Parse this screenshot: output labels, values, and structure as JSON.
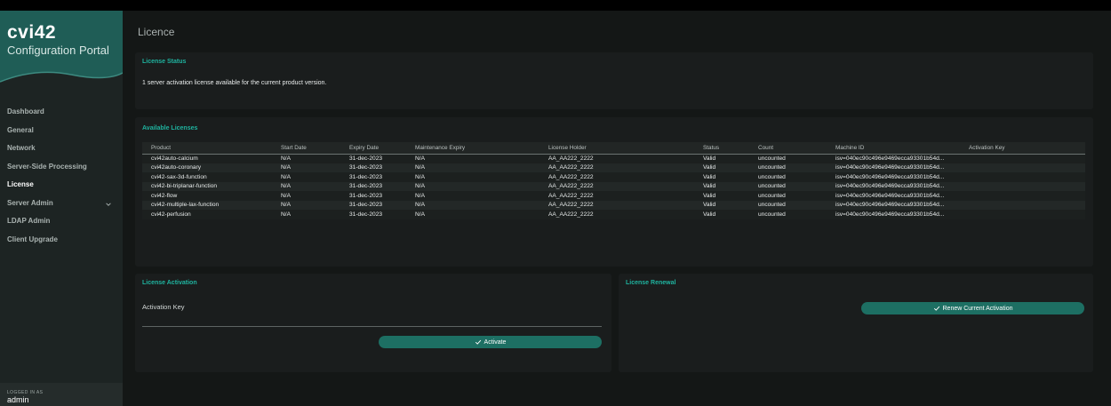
{
  "brand": {
    "logo": "cvi42",
    "subtitle": "Configuration Portal"
  },
  "nav": [
    {
      "label": "Dashboard",
      "active": false
    },
    {
      "label": "General",
      "active": false
    },
    {
      "label": "Network",
      "active": false
    },
    {
      "label": "Server-Side Processing",
      "active": false
    },
    {
      "label": "License",
      "active": true
    },
    {
      "label": "Server Admin",
      "active": false,
      "has_chevron": true
    },
    {
      "label": "LDAP Admin",
      "active": false
    },
    {
      "label": "Client Upgrade",
      "active": false
    }
  ],
  "footer": {
    "label": "LOGGED IN AS",
    "user": "admin"
  },
  "page": {
    "title": "Licence"
  },
  "status": {
    "title": "License Status",
    "text": "1 server activation license available for the current product version."
  },
  "available": {
    "title": "Available Licenses",
    "columns": [
      "Product",
      "Start Date",
      "Expiry Date",
      "Maintenance Expiry",
      "License Holder",
      "Status",
      "Count",
      "Machine ID",
      "Activation Key"
    ],
    "rows": [
      [
        "cvi42auto-calcium",
        "N/A",
        "31-dec-2023",
        "N/A",
        "AA_AA222_2222",
        "Valid",
        "uncounted",
        "isv=040ec90c496e9469ecca93301b54d...",
        ""
      ],
      [
        "cvi42auto-coronary",
        "N/A",
        "31-dec-2023",
        "N/A",
        "AA_AA222_2222",
        "Valid",
        "uncounted",
        "isv=040ec90c496e9469ecca93301b54d...",
        ""
      ],
      [
        "cvi42-sax-3d-function",
        "N/A",
        "31-dec-2023",
        "N/A",
        "AA_AA222_2222",
        "Valid",
        "uncounted",
        "isv=040ec90c496e9469ecca93301b54d...",
        ""
      ],
      [
        "cvi42-bi-triplanar-function",
        "N/A",
        "31-dec-2023",
        "N/A",
        "AA_AA222_2222",
        "Valid",
        "uncounted",
        "isv=040ec90c496e9469ecca93301b54d...",
        ""
      ],
      [
        "cvi42-flow",
        "N/A",
        "31-dec-2023",
        "N/A",
        "AA_AA222_2222",
        "Valid",
        "uncounted",
        "isv=040ec90c496e9469ecca93301b54d...",
        ""
      ],
      [
        "cvi42-multiple-lax-function",
        "N/A",
        "31-dec-2023",
        "N/A",
        "AA_AA222_2222",
        "Valid",
        "uncounted",
        "isv=040ec90c496e9469ecca93301b54d...",
        ""
      ],
      [
        "cvi42-perfusion",
        "N/A",
        "31-dec-2023",
        "N/A",
        "AA_AA222_2222",
        "Valid",
        "uncounted",
        "isv=040ec90c496e9469ecca93301b54d...",
        ""
      ]
    ]
  },
  "activation": {
    "title": "License Activation",
    "field_label": "Activation Key",
    "field_value": "",
    "button_label": "Activate"
  },
  "renewal": {
    "title": "License Renewal",
    "button_label": "Renew Current Activation"
  },
  "colors": {
    "accent": "#1fb39f",
    "button": "#1d6f63",
    "brand": "#1f5d56",
    "sidebar": "#1d2423",
    "card": "#1a1d1d",
    "background": "#141716"
  },
  "icons": {
    "nav_chevron": "chevron-down-icon",
    "button_check": "check-icon"
  }
}
